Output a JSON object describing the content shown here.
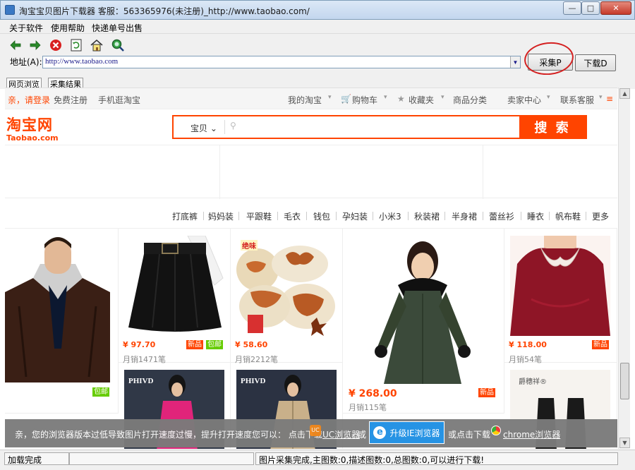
{
  "window": {
    "title": "淘宝宝贝图片下载器 客服：563365976(未注册)_http://www.taobao.com/",
    "min_label": "—",
    "max_label": "□",
    "close_label": "✕"
  },
  "menu": [
    "关于软件",
    "使用帮助",
    "快递单号出售"
  ],
  "toolbar": {
    "back_icon": "back-arrow-icon",
    "forward_icon": "forward-arrow-icon",
    "stop_icon": "stop-icon",
    "refresh_icon": "refresh-icon",
    "home_icon": "home-icon",
    "go_icon": "go-magnifier-icon"
  },
  "address": {
    "label": "地址(A):",
    "value": "http://www.taobao.com"
  },
  "buttons": {
    "collect": "采集P",
    "download": "下载D"
  },
  "tabs": [
    "网页浏览",
    "采集结果"
  ],
  "site": {
    "topbar": {
      "login": "亲，请登录",
      "register": "免费注册",
      "mobile": "手机逛淘宝",
      "my_taobao": "我的淘宝",
      "cart": "购物车",
      "favorites": "收藏夹",
      "categories": "商品分类",
      "seller": "卖家中心",
      "service": "联系客服",
      "menu": "≡"
    },
    "logo_cn": "淘宝网",
    "logo_en": "Taobao.com",
    "search": {
      "category": "宝贝",
      "button": "搜 索"
    },
    "hotwords": [
      "打底裤",
      "妈妈装",
      "平跟鞋",
      "毛衣",
      "钱包",
      "孕妇装",
      "小米3",
      "秋装裙",
      "半身裙",
      "蕾丝衫",
      "睡衣",
      "帆布鞋",
      "更多"
    ],
    "products": [
      {
        "price": "",
        "sales": "",
        "badges": [
          "包邮"
        ]
      },
      {
        "price": "¥ 97.70",
        "sales": "月销1471笔",
        "badges": [
          "新品",
          "包邮"
        ]
      },
      {
        "price": "¥ 58.60",
        "sales": "月销2212笔",
        "badges": []
      },
      {
        "price": "¥ 268.00",
        "sales": "月销115笔",
        "badges": [
          "新品"
        ]
      },
      {
        "price": "¥ 118.00",
        "sales": "月销54笔",
        "badges": [
          "新品"
        ]
      }
    ],
    "image_texts": {
      "snack_brand": "绝味",
      "brand1": "PHIVD",
      "brand2": "PHIVD",
      "brand3": "爵穗祥®"
    }
  },
  "infobar": {
    "message": "亲，您的浏览器版本过低导致图片打开速度过慢，提升打开速度您可以：  点击下载",
    "uc": "UC浏览器",
    "or1": "或",
    "ie": "升级IE浏览器",
    "or2": "或点击下载",
    "chrome": "chrome浏览器"
  },
  "status": {
    "left": "加载完成",
    "right": "图片采集完成,主图数:0,描述图数:0,总图数:0,可以进行下载!"
  }
}
